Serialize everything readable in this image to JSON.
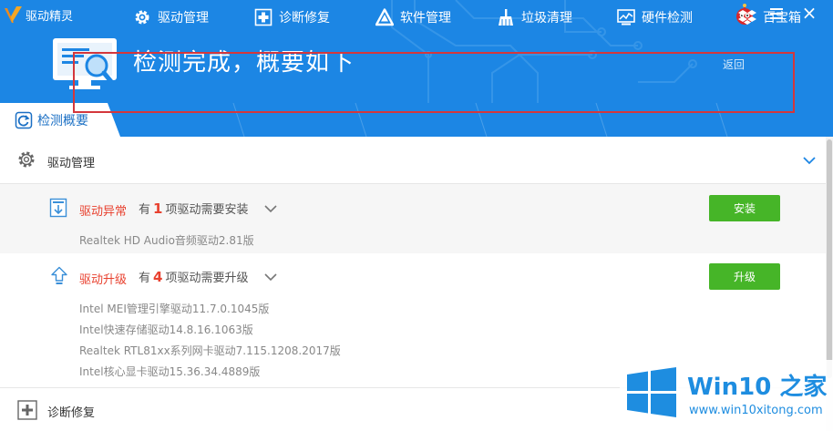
{
  "window": {
    "app_name": "驱动精灵",
    "menu_icon": "hamburger-icon",
    "close_icon": "close-icon",
    "close_glyph": "×"
  },
  "header": {
    "headline": "检测完成，概要如下",
    "back_label": "返回"
  },
  "tabs": [
    {
      "label": "检测概要",
      "icon": "refresh-icon",
      "active": true
    },
    {
      "label": "驱动管理",
      "icon": "gear-icon"
    },
    {
      "label": "诊断修复",
      "icon": "medical-cross-icon"
    },
    {
      "label": "软件管理",
      "icon": "triangle-logo-icon"
    },
    {
      "label": "垃圾清理",
      "icon": "broom-icon"
    },
    {
      "label": "硬件检测",
      "icon": "monitor-chart-icon"
    },
    {
      "label": "百宝箱",
      "icon": "boxes-icon"
    }
  ],
  "driver_section": {
    "title": "驱动管理",
    "abnormal": {
      "title": "驱动异常",
      "desc_prefix": "有",
      "count": "1",
      "desc_suffix": "项驱动需要安装",
      "button": "安装",
      "items": [
        "Realtek HD Audio音频驱动2.81版"
      ]
    },
    "upgrade": {
      "title": "驱动升级",
      "desc_prefix": "有",
      "count": "4",
      "desc_suffix": "项驱动需要升级",
      "button": "升级",
      "items": [
        "Intel MEI管理引擎驱动11.7.0.1045版",
        "Intel快速存储驱动14.8.16.1063版",
        "Realtek RTL81xx系列网卡驱动7.115.1208.2017版",
        "Intel核心显卡驱动15.36.34.4889版"
      ]
    }
  },
  "repair_section": {
    "title": "诊断修复"
  },
  "watermark": {
    "title": "Win10 之家",
    "url": "www.win10xitong.com"
  },
  "colors": {
    "header_blue": "#1c86e4",
    "alert_red": "#e8412f",
    "button_green": "#46b528",
    "watermark_blue": "#1e8de0"
  }
}
